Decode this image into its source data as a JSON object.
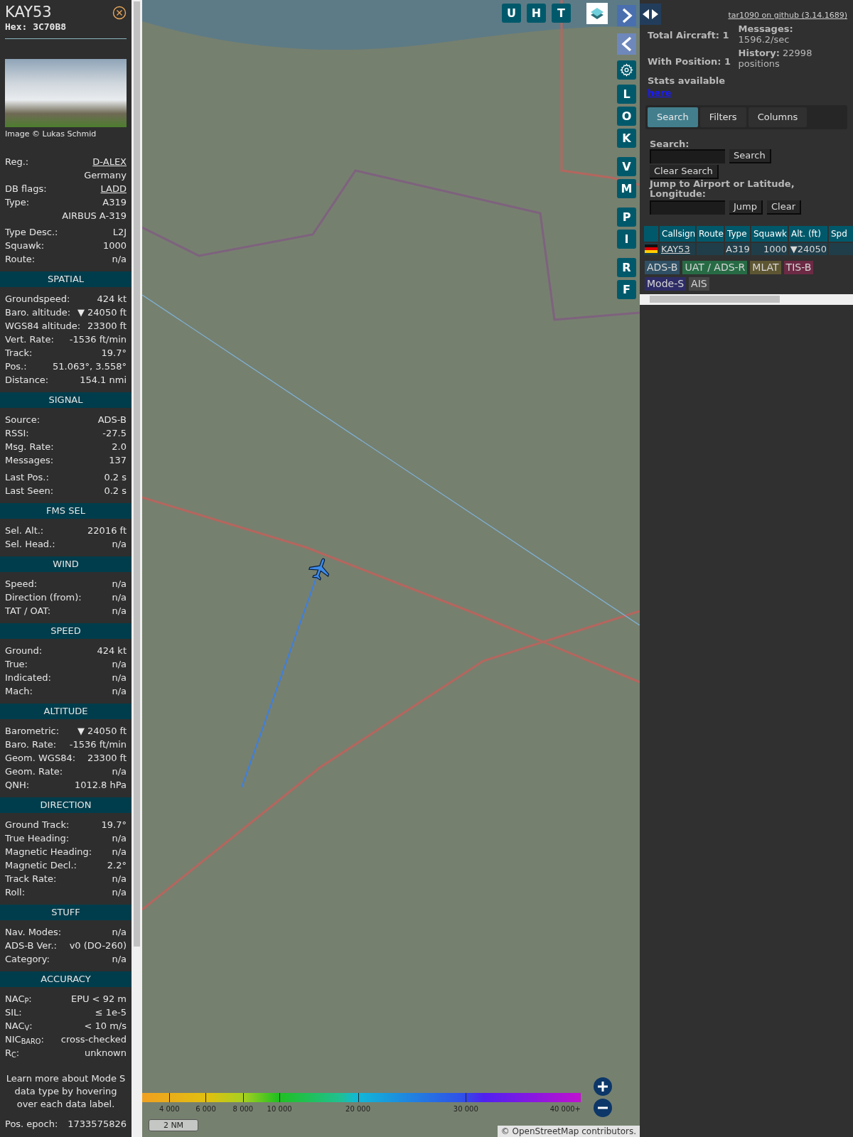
{
  "detail": {
    "callsign": "KAY53",
    "hex": "Hex: 3C70B8",
    "photo_caption": "Image © Lukas Schmid",
    "info_groups": [
      [
        {
          "label": "Reg.:",
          "value": "D-ALEX",
          "link": true
        },
        {
          "value": "Germany",
          "link": false
        },
        {
          "label": "DB flags:",
          "value": "LADD",
          "link": true
        },
        {
          "label": "Type:",
          "value": "A319",
          "link": false
        },
        {
          "value": "AIRBUS A-319",
          "link": false
        }
      ],
      [
        {
          "label": "Type Desc.:",
          "value": "L2J",
          "link": false
        },
        {
          "label": "Squawk:",
          "value": "1000",
          "link": false
        },
        {
          "label": "Route:",
          "value": "n/a",
          "link": false
        }
      ]
    ],
    "sections": [
      {
        "title": "SPATIAL",
        "groups": [
          [
            {
              "label": "Groundspeed:",
              "value": "424 kt"
            },
            {
              "label": "Baro. altitude:",
              "value": "▼ 24050 ft"
            },
            {
              "label": "WGS84 altitude:",
              "value": "23300 ft"
            },
            {
              "label": "Vert. Rate:",
              "value": "-1536 ft/min"
            },
            {
              "label": "Track:",
              "value": "19.7°"
            },
            {
              "label": "Pos.:",
              "value": "51.063°, 3.558°"
            },
            {
              "label": "Distance:",
              "value": "154.1 nmi"
            }
          ]
        ]
      },
      {
        "title": "SIGNAL",
        "groups": [
          [
            {
              "label": "Source:",
              "value": "ADS-B"
            },
            {
              "label": "RSSI:",
              "value": "-27.5"
            },
            {
              "label": "Msg. Rate:",
              "value": "2.0"
            },
            {
              "label": "Messages:",
              "value": "137"
            }
          ],
          [
            {
              "label": "Last Pos.:",
              "value": "0.2 s"
            },
            {
              "label": "Last Seen:",
              "value": "0.2 s"
            }
          ]
        ]
      },
      {
        "title": "FMS SEL",
        "groups": [
          [
            {
              "label": "Sel. Alt.:",
              "value": "22016 ft"
            },
            {
              "label": "Sel. Head.:",
              "value": "n/a"
            }
          ]
        ]
      },
      {
        "title": "WIND",
        "groups": [
          [
            {
              "label": "Speed:",
              "value": "n/a"
            },
            {
              "label": "Direction (from):",
              "value": "n/a"
            },
            {
              "label": "TAT / OAT:",
              "value": "n/a"
            }
          ]
        ]
      },
      {
        "title": "SPEED",
        "groups": [
          [
            {
              "label": "Ground:",
              "value": "424 kt"
            },
            {
              "label": "True:",
              "value": "n/a"
            },
            {
              "label": "Indicated:",
              "value": "n/a"
            },
            {
              "label": "Mach:",
              "value": "n/a"
            }
          ]
        ]
      },
      {
        "title": "ALTITUDE",
        "groups": [
          [
            {
              "label": "Barometric:",
              "value": "▼ 24050 ft"
            },
            {
              "label": "Baro. Rate:",
              "value": "-1536 ft/min"
            },
            {
              "label": "Geom. WGS84:",
              "value": "23300 ft"
            },
            {
              "label": "Geom. Rate:",
              "value": "n/a"
            },
            {
              "label": "QNH:",
              "value": "1012.8 hPa"
            }
          ]
        ]
      },
      {
        "title": "DIRECTION",
        "groups": [
          [
            {
              "label": "Ground Track:",
              "value": "19.7°"
            },
            {
              "label": "True Heading:",
              "value": "n/a"
            },
            {
              "label": "Magnetic Heading:",
              "value": "n/a"
            },
            {
              "label": "Magnetic Decl.:",
              "value": "2.2°"
            },
            {
              "label": "Track Rate:",
              "value": "n/a"
            },
            {
              "label": "Roll:",
              "value": "n/a"
            }
          ]
        ]
      },
      {
        "title": "STUFF",
        "groups": [
          [
            {
              "label": "Nav. Modes:",
              "value": "n/a"
            },
            {
              "label": "ADS-B Ver.:",
              "value": "v0 (DO-260)"
            },
            {
              "label": "Category:",
              "value": "n/a"
            }
          ]
        ]
      },
      {
        "title": "ACCURACY",
        "groups": [
          [
            {
              "label": "NAC$_{P}$:",
              "value": "EPU < 92 m"
            },
            {
              "label": "SIL:",
              "value": "≤ 1e-5"
            },
            {
              "label": "NAC$_{V}$:",
              "value": "< 10 m/s"
            },
            {
              "label": "NIC$_{BARO}$:",
              "value": "cross-checked"
            },
            {
              "label": "R$_{C}$:",
              "value": "unknown"
            }
          ]
        ]
      }
    ],
    "note": "Learn more about Mode S data type by hovering over each data label.",
    "epoch": {
      "label": "Pos. epoch:",
      "value": "1733575826"
    }
  },
  "map": {
    "top_buttons": [
      "U",
      "H",
      "T"
    ],
    "side_button_groups": [
      [
        "L",
        "O",
        "K"
      ],
      [
        "V",
        "M"
      ],
      [
        "P",
        "I"
      ],
      [
        "R",
        "F"
      ]
    ],
    "altitude_scale": [
      "4 000",
      "6 000",
      "8 000",
      "10 000",
      "20 000",
      "30 000",
      "40 000+"
    ],
    "scale_bar": "2 NM",
    "attribution": "© OpenStreetMap contributors."
  },
  "panel": {
    "github_link": "tar1090 on github (3.14.1689)",
    "stats_left": [
      {
        "label": "Total Aircraft:",
        "value": "1"
      },
      {
        "label": "With Position:",
        "value": "1"
      }
    ],
    "stats_text": "Stats available",
    "stats_link": "here",
    "stats_right": [
      {
        "label": "Messages:",
        "value": "1596.2/sec"
      },
      {
        "label": "History:",
        "value": "22998 positions"
      }
    ],
    "tabs": [
      {
        "label": "Search",
        "selected": true
      },
      {
        "label": "Filters",
        "selected": false
      },
      {
        "label": "Columns",
        "selected": false
      }
    ],
    "search": {
      "label": "Search:",
      "search_button": "Search",
      "clear_button": "Clear Search",
      "jump_label": "Jump to Airport or Latitude, Longitude:",
      "jump_button": "Jump",
      "jump_clear_button": "Clear"
    },
    "table": {
      "columns": [
        "Callsign",
        "Route",
        "Type",
        "Squawk",
        "Alt. (ft)",
        "Spd"
      ],
      "rows": [
        {
          "callsign": "KAY53",
          "type": "A319",
          "squawk": "1000",
          "altitude": "▼24050"
        }
      ]
    },
    "legend": [
      {
        "label": "ADS-B",
        "color": "#2f5065"
      },
      {
        "label": "UAT / ADS-R",
        "color": "#276b45"
      },
      {
        "label": "MLAT",
        "color": "#5e5633"
      },
      {
        "label": "TIS-B",
        "color": "#6c2a44"
      },
      {
        "label": "Mode-S",
        "color": "#2e2c66"
      },
      {
        "label": "AIS",
        "color": "#474747"
      }
    ]
  }
}
